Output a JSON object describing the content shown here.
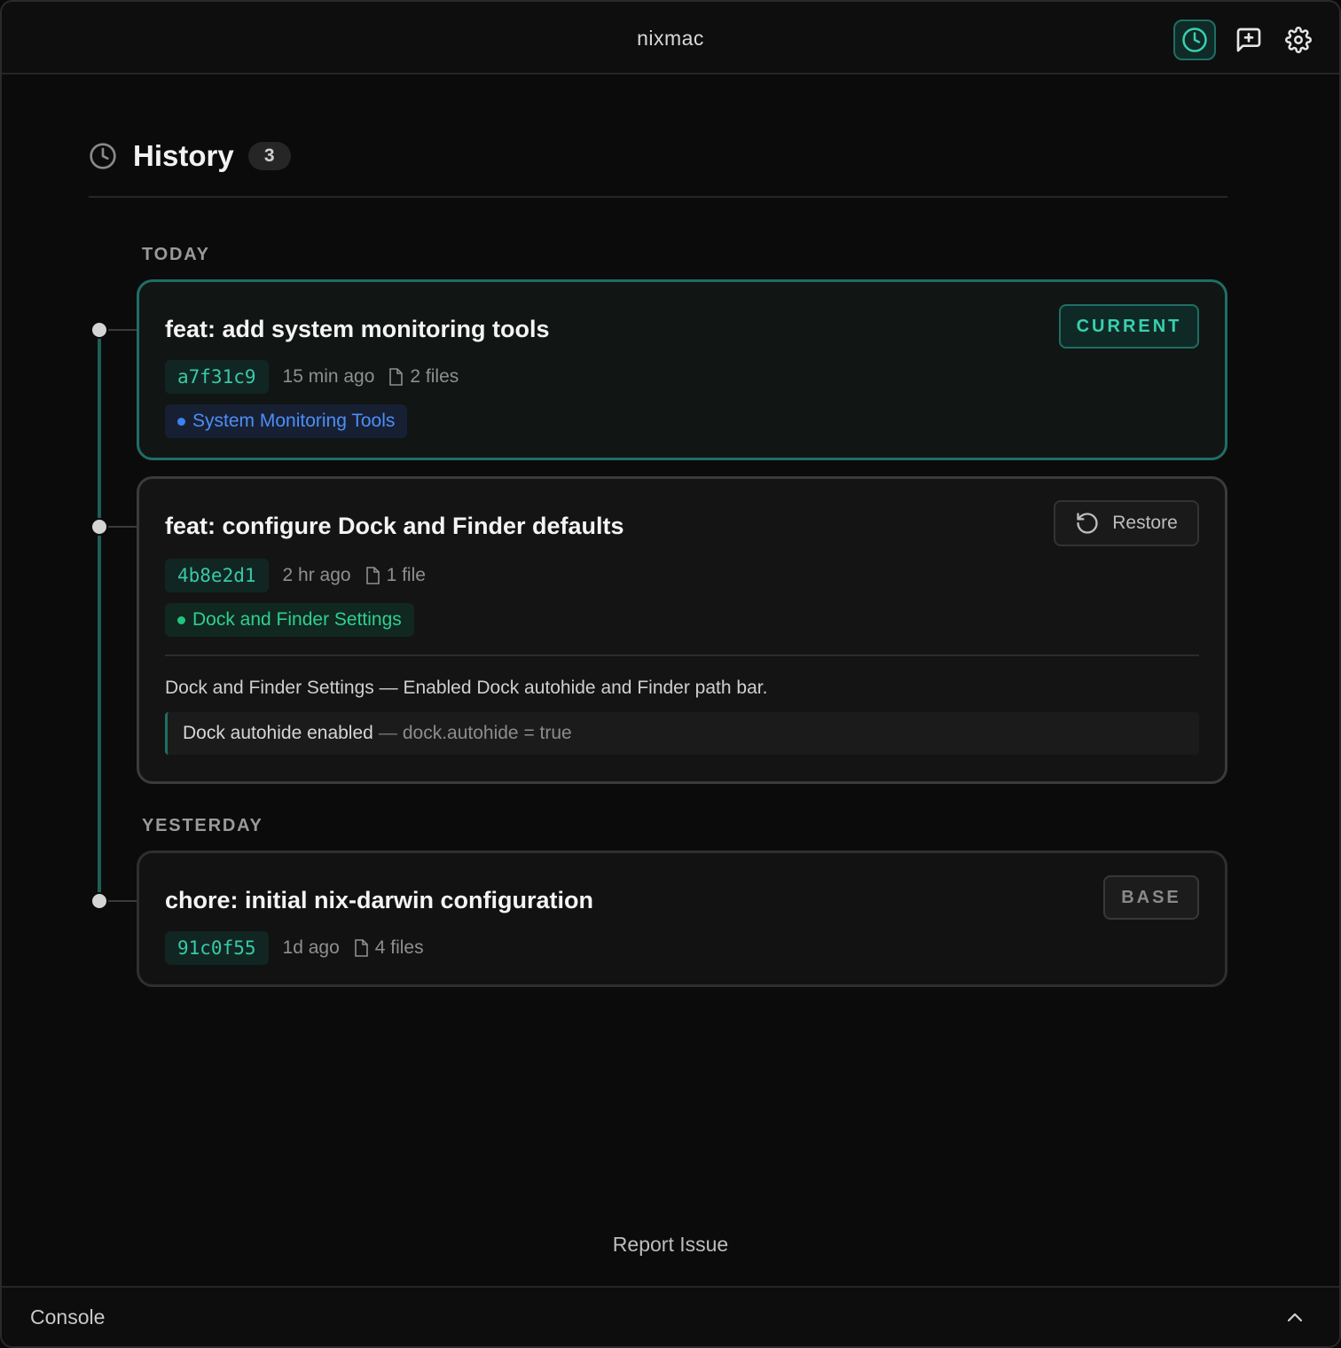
{
  "app": {
    "title": "nixmac"
  },
  "toolbar": {
    "history_icon": "clock-icon",
    "new_chat_icon": "message-plus-icon",
    "settings_icon": "gear-icon"
  },
  "history": {
    "title": "History",
    "count": "3"
  },
  "groups": [
    {
      "label": "TODAY"
    },
    {
      "label": "YESTERDAY"
    }
  ],
  "commits": [
    {
      "title": "feat: add system monitoring tools",
      "hash": "a7f31c9",
      "ago": "15 min ago",
      "files": "2 files",
      "tag": "System Monitoring Tools",
      "badge": "CURRENT"
    },
    {
      "title": "feat: configure Dock and Finder defaults",
      "hash": "4b8e2d1",
      "ago": "2 hr ago",
      "files": "1 file",
      "tag": "Dock and Finder Settings",
      "action": "Restore",
      "summary": "Dock and Finder Settings — Enabled Dock autohide and Finder path bar.",
      "change": {
        "title": "Dock autohide enabled",
        "separator": "—",
        "value": "dock.autohide = true"
      }
    },
    {
      "title": "chore: initial nix-darwin configuration",
      "hash": "91c0f55",
      "ago": "1d ago",
      "files": "4 files",
      "badge": "BASE"
    }
  ],
  "footer": {
    "report": "Report Issue",
    "console": "Console"
  },
  "colors": {
    "accent": "#38d0b0",
    "accent_border": "#1f6e64",
    "tag_blue": "#4d8ef7",
    "tag_green": "#2fcf8f"
  }
}
